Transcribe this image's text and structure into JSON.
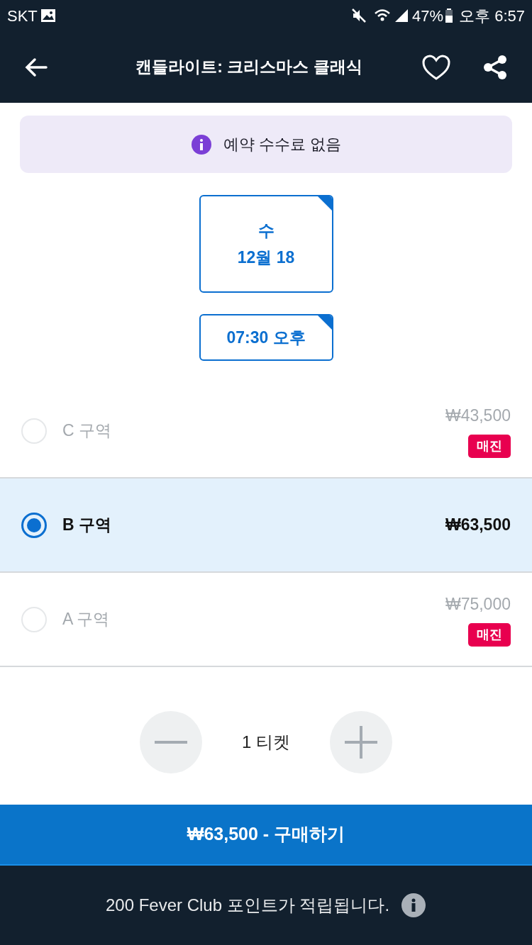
{
  "status_bar": {
    "carrier": "SKT",
    "battery": "47%",
    "time": "오후 6:57"
  },
  "header": {
    "title": "캔들라이트: 크리스마스 클래식"
  },
  "notice": {
    "text": "예약 수수료 없음"
  },
  "dates": [
    {
      "weekday": "수",
      "date": "12월 18",
      "selected": true
    }
  ],
  "times": [
    {
      "time": "07:30 오후",
      "selected": true
    }
  ],
  "zones": [
    {
      "name": "C 구역",
      "price": "₩43,500",
      "badge": "매진",
      "selected": false,
      "disabled": true
    },
    {
      "name": "B 구역",
      "price": "₩63,500",
      "selected": true,
      "disabled": false
    },
    {
      "name": "A 구역",
      "price": "₩75,000",
      "badge": "매진",
      "selected": false,
      "disabled": true
    }
  ],
  "quantity": {
    "label": "1 티켓"
  },
  "buy_button": {
    "label": "₩63,500 - 구매하기"
  },
  "footer": {
    "text": "200 Fever Club 포인트가 적립됩니다."
  }
}
